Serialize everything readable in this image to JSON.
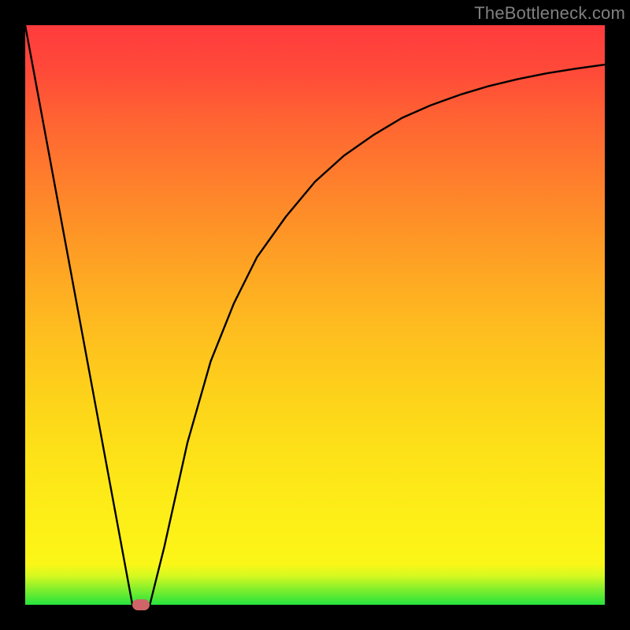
{
  "watermark": {
    "text": "TheBottleneck.com"
  },
  "chart_data": {
    "type": "line",
    "title": "",
    "xlabel": "",
    "ylabel": "",
    "xlim": [
      0,
      100
    ],
    "ylim": [
      0,
      100
    ],
    "grid": false,
    "legend": false,
    "series": [
      {
        "name": "curve",
        "x": [
          0,
          18.5,
          21.5,
          24,
          28,
          32,
          36,
          40,
          45,
          50,
          55,
          60,
          65,
          70,
          75,
          80,
          85,
          90,
          95,
          100
        ],
        "y": [
          100,
          0,
          0,
          10,
          28,
          42,
          52,
          60,
          67,
          73,
          77.5,
          81,
          84,
          86.2,
          88,
          89.5,
          90.7,
          91.7,
          92.5,
          93.2
        ]
      }
    ],
    "marker": {
      "x_start": 18.5,
      "x_end": 21.5,
      "y": 0,
      "color": "#cf6568"
    },
    "background_gradient": {
      "bottom": "#26e33d",
      "middle": "#fde318",
      "top": "#ff3b3d"
    }
  }
}
